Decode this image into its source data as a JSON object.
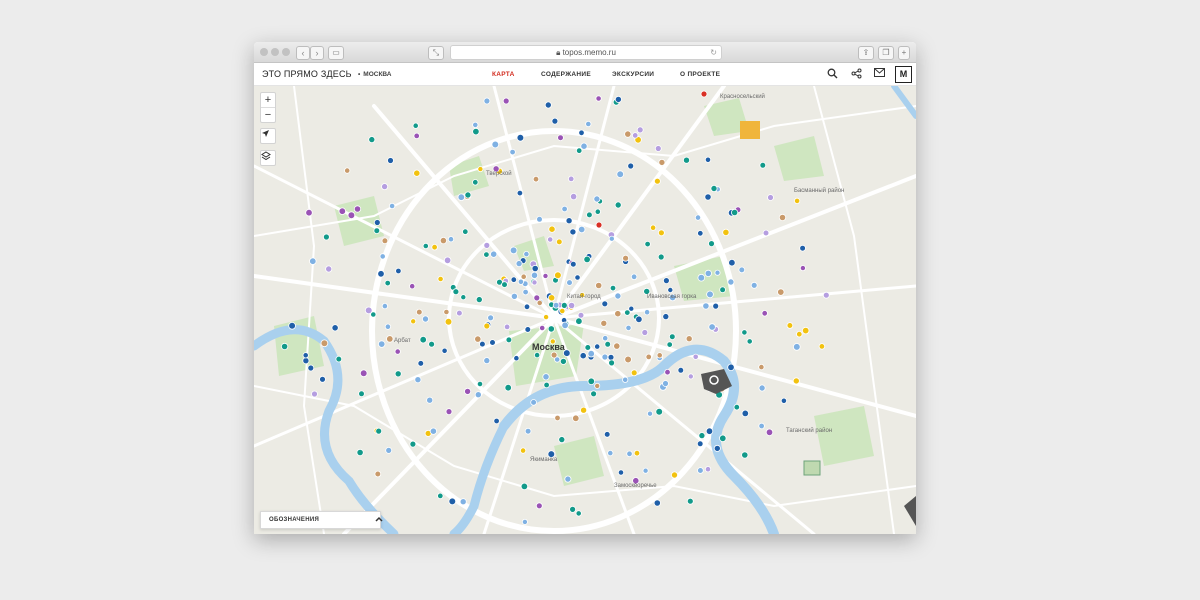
{
  "browser": {
    "url": "topos.memo.ru",
    "back_icon": "chevron-left-icon",
    "forward_icon": "chevron-right-icon"
  },
  "header": {
    "brand": "ЭТО ПРЯМО ЗДЕСЬ",
    "city": "МОСКВА",
    "nav": [
      {
        "label": "КАРТА",
        "active": true
      },
      {
        "label": "СОДЕРЖАНИЕ",
        "active": false
      },
      {
        "label": "ЭКСКУРСИИ",
        "active": false
      },
      {
        "label": "О ПРОЕКТЕ",
        "active": false
      }
    ],
    "icons": [
      "search-icon",
      "share-icon",
      "mail-icon",
      "memorial-logo-icon"
    ],
    "accent_color": "#d22b1e"
  },
  "map_controls": {
    "zoom_in": "+",
    "zoom_out": "−",
    "locate_icon": "location-arrow-icon",
    "layers_icon": "layers-icon"
  },
  "legend": {
    "label": "ОБОЗНАЧЕНИЯ",
    "toggle_icon": "chevron-up-icon"
  },
  "map": {
    "labels": [
      {
        "text": "Красносельский",
        "kind": "district"
      },
      {
        "text": "Тверской",
        "kind": "district"
      },
      {
        "text": "Басманный район",
        "kind": "district"
      },
      {
        "text": "Китай-город",
        "kind": "district"
      },
      {
        "text": "Ивановская горка",
        "kind": "district"
      },
      {
        "text": "Москва",
        "kind": "city"
      },
      {
        "text": "Арбат",
        "kind": "district"
      },
      {
        "text": "Таганский район",
        "kind": "district"
      },
      {
        "text": "Якиманка",
        "kind": "district"
      },
      {
        "text": "Замоскворечье",
        "kind": "district"
      }
    ],
    "marker_colors": {
      "dark_blue": "#1f5fa8",
      "light_blue": "#7fb1e3",
      "teal": "#129a8a",
      "purple": "#9a53b5",
      "lavender": "#b59ee0",
      "tan": "#c99a6a",
      "yellow": "#f2c20f",
      "red": "#d93025"
    }
  }
}
